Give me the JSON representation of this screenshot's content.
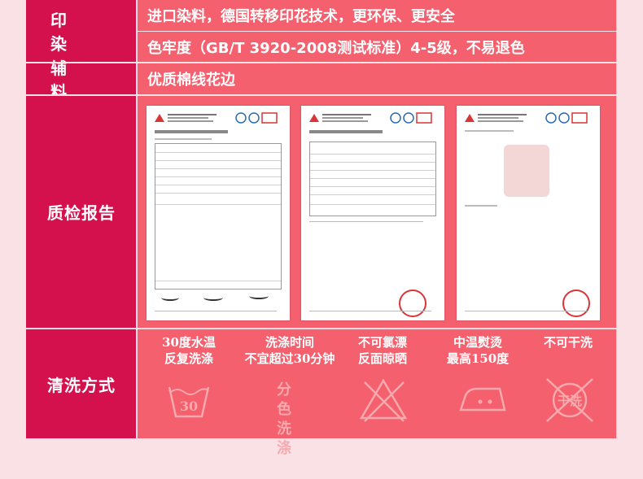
{
  "rows": {
    "printing": {
      "label": "印　染",
      "line1": "进口染料，德国转移印花技术，更环保、更安全",
      "line2": "色牢度（GB/T 3920-2008测试标准）4-5级，不易退色"
    },
    "trim": {
      "label": "辅　料",
      "text": "优质棉线花边"
    },
    "inspection": {
      "label": "质检报告"
    },
    "washing": {
      "label": "清洗方式",
      "items": [
        {
          "line1": "30度水温",
          "line2": "反复洗涤",
          "icon": "wash-30-icon",
          "icon_text": "30"
        },
        {
          "line1": "洗涤时间",
          "line2": "不宜超过30分钟",
          "icon": "separate-wash-icon",
          "icon_text": "分色洗涤"
        },
        {
          "line1": "不可氯漂",
          "line2": "反面晾晒",
          "icon": "no-bleach-icon"
        },
        {
          "line1": "中温熨烫",
          "line2": "最高150度",
          "icon": "iron-medium-icon"
        },
        {
          "line1": "不可干洗",
          "line2": "",
          "icon": "no-dry-clean-icon",
          "icon_text": "干洗"
        }
      ]
    }
  },
  "colors": {
    "label_bg": "#d4114d",
    "content_bg": "#f4606e",
    "panel_bg": "#f5c8d2",
    "page_bg": "#f9e1e6",
    "icon_color": "#f7a9ad"
  }
}
